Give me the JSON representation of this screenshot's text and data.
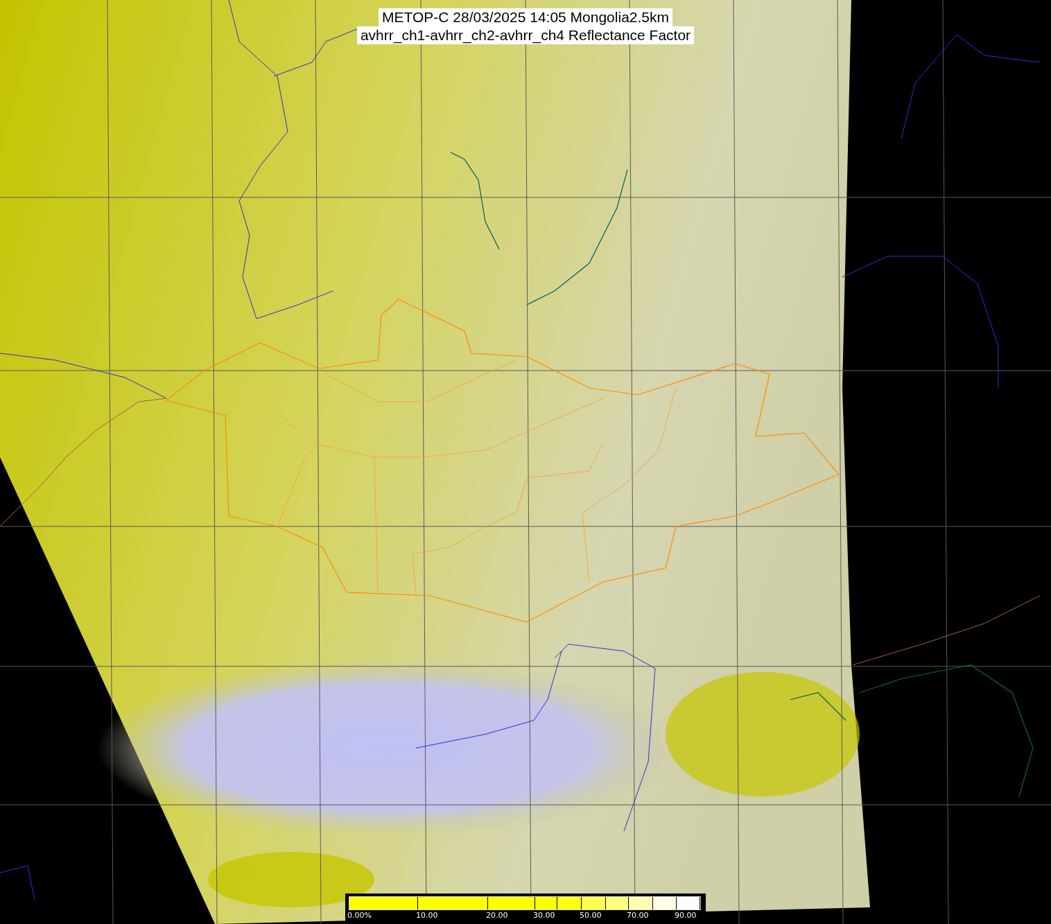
{
  "title_lines": [
    "METOP-C 28/03/2025 14:05 Mongolia2.5km",
    "avhrr_ch1-avhrr_ch2-avhrr_ch4 Reflectance Factor"
  ],
  "colorbar": {
    "segments": [
      {
        "color": "#ffff00",
        "label": "0.00%"
      },
      {
        "color": "#ffff00",
        "label": "10.00"
      },
      {
        "color": "#ffff00",
        "label": "20.00"
      },
      {
        "color": "#ffff00",
        "label": "30.00"
      },
      {
        "color": "#ffff10"
      },
      {
        "color": "#ffff50",
        "label": "50.00"
      },
      {
        "color": "#ffff80"
      },
      {
        "color": "#ffffb0",
        "label": "70.00"
      },
      {
        "color": "#ffffe8"
      },
      {
        "color": "#ffffff",
        "label": "90.00"
      }
    ]
  }
}
